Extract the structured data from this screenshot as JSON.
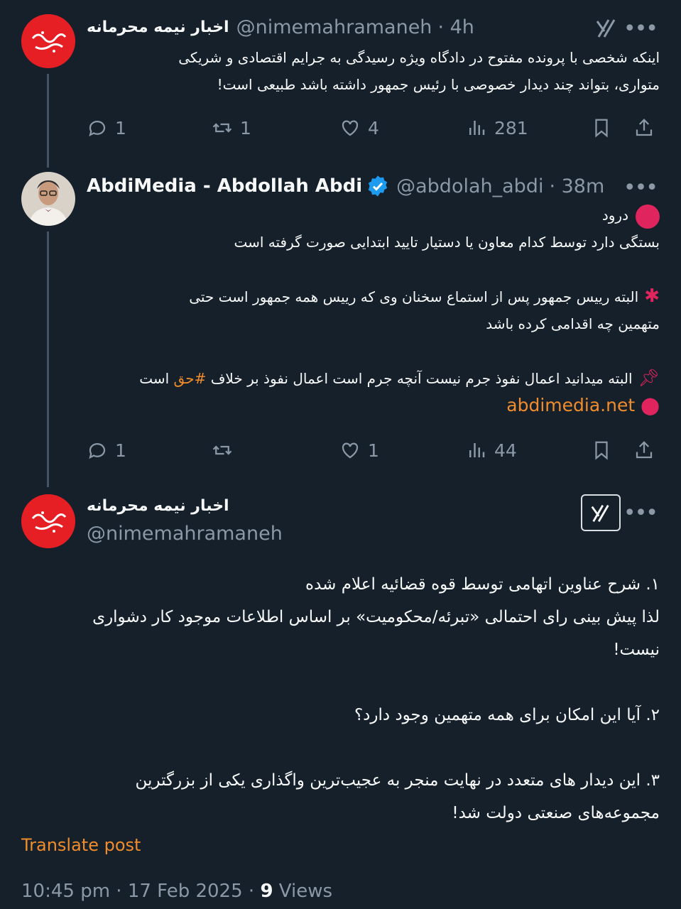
{
  "tweet1": {
    "name": "اخبار نیمه محرمانه",
    "handle": "@nimemahramaneh",
    "time": "· 4h",
    "lines": [
      "اینکه شخصی با پرونده مفتوح در دادگاه ویژه رسیدگی به جرایم اقتصادی و شریکی",
      "متواری، بتواند چند دیدار خصوصی با رئیس جمهور داشته باشد طبیعی است!"
    ],
    "replies": "1",
    "reposts": "1",
    "likes": "4",
    "views": "281"
  },
  "tweet2": {
    "name": "AbdiMedia - Abdollah Abdi",
    "handle": "@abdolah_abdi",
    "time": "· 38m",
    "greeting": "درود",
    "line1": "بستگی دارد توسط کدام معاون یا دستیار تایید ابتدایی صورت گرفته است",
    "line2": "البته رییس جمهور پس از استماع سخنان وی که رییس همه جمهور است حتی",
    "line3": "متهمین چه اقدامی کرده باشد",
    "line4_pre": "البته میدانید اعمال نفوذ جرم نیست آنچه جرم است اعمال نفوذ بر خلاف",
    "hashtag": "#حق",
    "line4_post": "است",
    "link": "abdimedia.net",
    "replies": "1",
    "reposts": "",
    "likes": "1",
    "views": "44"
  },
  "main": {
    "name": "اخبار نیمه محرمانه",
    "handle": "@nimemahramaneh",
    "p1a": "۱. شرح عناوین اتهامی توسط قوه قضائیه اعلام شده",
    "p1b": "لذا پیش بینی رای احتمالی «تبرئه/محکومیت» بر اساس اطلاعات موجود کار دشواری",
    "p1c": "نیست!",
    "p2": "۲. آیا این امکان برای همه متهمین وجود دارد؟",
    "p3a": "۳. این دیدار های متعدد در نهایت منجر به عجیب‌ترین واگذاری یکی از بزرگترین",
    "p3b": "مجموعه‌های صنعتی دولت شد!",
    "translate": "Translate post",
    "timestamp": "10:45 pm · 17 Feb 2025 · ",
    "views_count": "9",
    "views_label": " Views"
  },
  "icons": {
    "reply": "reply-icon",
    "repost": "repost-icon",
    "like": "heart-icon",
    "views": "views-icon",
    "bookmark": "bookmark-icon",
    "share": "share-icon",
    "grok": "grok-icon",
    "more": "more-icon",
    "verified": "verified-badge-icon"
  },
  "colors": {
    "background": "#15202b",
    "accent": "#f08c2b",
    "muted": "#8b98a5",
    "verified": "#1d9bf0",
    "brand_red": "#e51f24"
  }
}
